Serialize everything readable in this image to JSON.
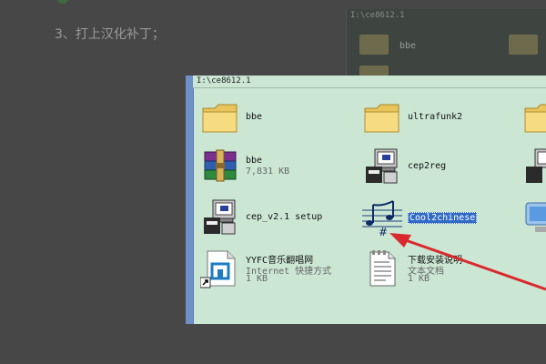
{
  "background": {
    "step_text": "3、打上汉化补丁；",
    "path": "I:\\ce8612.1",
    "folder_label": "bbe"
  },
  "window": {
    "path": "I:\\ce8612.1"
  },
  "items": [
    {
      "name": "bbe",
      "icon": "folder-icon"
    },
    {
      "name": "ultrafunk2",
      "icon": "folder-icon"
    },
    {
      "name": "bbe",
      "sub": "7,831 KB",
      "icon": "winrar-archive-icon"
    },
    {
      "name": "cep2reg",
      "icon": "installer-program-icon"
    },
    {
      "name": "cep_v2.1 setup",
      "icon": "installer-program-icon"
    },
    {
      "name": "Cool2chinese",
      "icon": "music-notes-icon",
      "selected": true
    },
    {
      "name": "YYFC音乐翻唱网",
      "sub": "Internet 快捷方式",
      "sub2": "1 KB",
      "icon": "internet-shortcut-icon"
    },
    {
      "name": "下载安装说明",
      "sub": "文本文档",
      "sub2": "1 KB",
      "icon": "text-document-icon"
    }
  ],
  "colors": {
    "window_bg": "#cbe7d4",
    "selection": "#316ac5",
    "arrow": "#d9292e"
  }
}
